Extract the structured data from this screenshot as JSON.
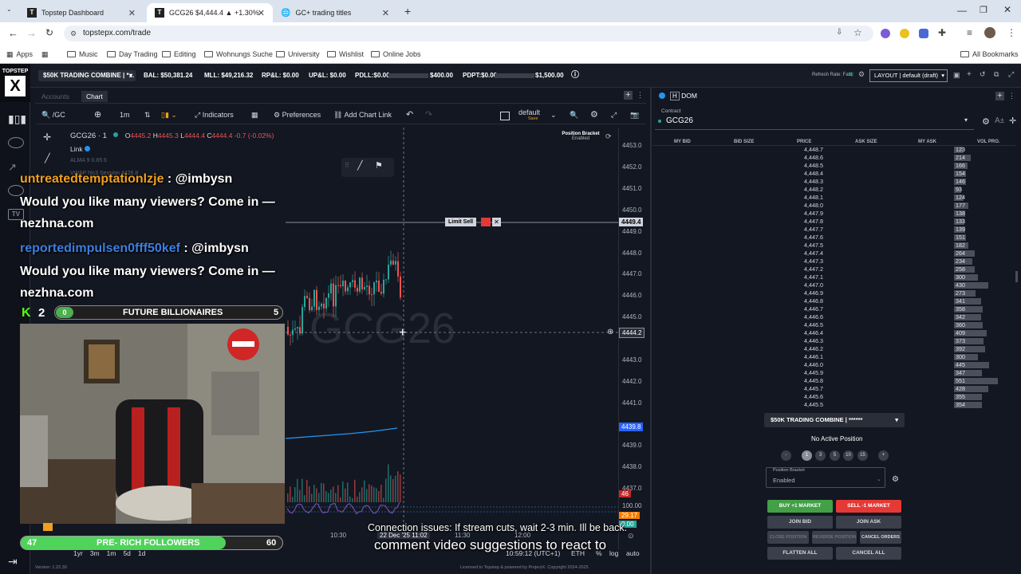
{
  "browser": {
    "tabs": [
      {
        "title": "Topstep Dashboard",
        "favicon": "T"
      },
      {
        "title": "GCG26 $4,444.4 ▲ +1.30%",
        "favicon": "T"
      },
      {
        "title": "GC+ trading titles",
        "favicon": "globe"
      }
    ],
    "url": "topstepx.com/trade",
    "bookmarks": [
      "Apps",
      "Music",
      "Day Trading",
      "Editing",
      "Wohnungs Suche",
      "University",
      "Wishlist",
      "Online Jobs"
    ],
    "all_bookmarks": "All Bookmarks"
  },
  "topbar": {
    "account": "$50K TRADING COMBINE | *...",
    "bal": "BAL: $50,381.24",
    "mll": "MLL: $49,216.32",
    "rpl": "RP&L: $0.00",
    "upl": "UP&L: $0.00",
    "pdll": "PDLL:$0.00",
    "pdll_limit": "$400.00",
    "pdpt": "PDPT:$0.00",
    "pdpt_limit": "$1,500.00",
    "refresh": "Refresh Rate: Fast",
    "layout": "LAYOUT | default (draft)"
  },
  "chart": {
    "tabs": [
      "Accounts",
      "Chart"
    ],
    "symbol_search": "/GC",
    "interval": "1m",
    "indicators": "Indicators",
    "preferences": "Preferences",
    "add_link": "Add Chart Link",
    "template": "default",
    "template_save": "Save",
    "instrument": "GCG26 · 1",
    "ohlc": {
      "o": "4445.2",
      "h": "4445.3",
      "l": "4444.4",
      "c": "4444.4",
      "chg": "-0.7 (-0.02%)"
    },
    "link": "Link",
    "alma": "ALMA 9 0.85 6",
    "vwap": "VWAP hlc3 Session 4426.8",
    "position_bracket": "Position Bracket",
    "position_bracket_status": "Enabled",
    "limit_sell": "Limit Sell",
    "watermark": "GCG26",
    "price_labels": [
      "4453.0",
      "4452.0",
      "4451.0",
      "4450.0",
      "4449.0",
      "4448.0",
      "4447.0",
      "4446.0",
      "4445.0",
      "4443.0",
      "4442.0",
      "4441.0",
      "4439.0",
      "4438.0",
      "4437.0"
    ],
    "limit_price": "4449.4",
    "current_price": "4444.2",
    "vwap_price": "4439.8",
    "osc_labels": {
      "high": "100.00",
      "mid": "29.17",
      "low": "0.00",
      "red": "46"
    },
    "time_labels": [
      "10:30",
      "22 Dec '25  11:02",
      "11:30",
      "12:00"
    ],
    "clock": "10:59:12 (UTC+1)",
    "eth": "ETH",
    "pct": "%",
    "log": "log",
    "auto": "auto",
    "ranges": [
      "1yr",
      "3m",
      "1m",
      "5d",
      "1d"
    ],
    "ohlc_colors": {
      "up": "#26a69a",
      "down": "#ef5350"
    }
  },
  "dom": {
    "title": "DOM",
    "contract_label": "Contract",
    "contract": "GCG26",
    "headers": [
      "MY BID",
      "BID SIZE",
      "PRICE",
      "ASK SIZE",
      "MY ASK",
      "VOL PRO."
    ],
    "rows": [
      {
        "price": "4,448.7",
        "vol": 123
      },
      {
        "price": "4,448.6",
        "vol": 214
      },
      {
        "price": "4,448.5",
        "vol": 166
      },
      {
        "price": "4,448.4",
        "vol": 154
      },
      {
        "price": "4,448.3",
        "vol": 146
      },
      {
        "price": "4,448.2",
        "vol": 93
      },
      {
        "price": "4,448.1",
        "vol": 124
      },
      {
        "price": "4,448.0",
        "vol": 177
      },
      {
        "price": "4,447.9",
        "vol": 138
      },
      {
        "price": "4,447.8",
        "vol": 133
      },
      {
        "price": "4,447.7",
        "vol": 139
      },
      {
        "price": "4,447.6",
        "vol": 151
      },
      {
        "price": "4,447.5",
        "vol": 182
      },
      {
        "price": "4,447.4",
        "vol": 264
      },
      {
        "price": "4,447.3",
        "vol": 234
      },
      {
        "price": "4,447.2",
        "vol": 258
      },
      {
        "price": "4,447.1",
        "vol": 300
      },
      {
        "price": "4,447.0",
        "vol": 430
      },
      {
        "price": "4,446.9",
        "vol": 273
      },
      {
        "price": "4,446.8",
        "vol": 341
      },
      {
        "price": "4,446.7",
        "vol": 358
      },
      {
        "price": "4,446.6",
        "vol": 342
      },
      {
        "price": "4,446.5",
        "vol": 360
      },
      {
        "price": "4,446.4",
        "vol": 409
      },
      {
        "price": "4,446.3",
        "vol": 373
      },
      {
        "price": "4,446.2",
        "vol": 392
      },
      {
        "price": "4,446.1",
        "vol": 300
      },
      {
        "price": "4,446.0",
        "vol": 445
      },
      {
        "price": "4,445.9",
        "vol": 347
      },
      {
        "price": "4,445.8",
        "vol": 551
      },
      {
        "price": "4,445.7",
        "vol": 428
      },
      {
        "price": "4,445.6",
        "vol": 355
      },
      {
        "price": "4,445.5",
        "vol": 354
      }
    ],
    "account": "$50K TRADING COMBINE | ******",
    "no_position": "No Active Position",
    "quantities": [
      "-",
      "1",
      "3",
      "5",
      "10",
      "15",
      "+"
    ],
    "bracket_label": "Position Bracket",
    "bracket_value": "Enabled",
    "buy": "BUY +1 MARKET",
    "sell": "SELL -1 MARKET",
    "join_bid": "JOIN BID",
    "join_ask": "JOIN ASK",
    "close_position": "CLOSE POSITION",
    "reverse_position": "REVERSE POSITION",
    "cancel_orders": "CANCEL ORDERS",
    "flatten_all": "FLATTEN ALL",
    "cancel_all": "CANCEL ALL"
  },
  "overlay": {
    "chat": [
      {
        "user": "untreatedtemptationlzje",
        "text": ": @imbysn",
        "msg": "Would you like many viewers? Come in — nezhna.com"
      },
      {
        "user": "reportedimpulsen0fff50kef",
        "text": ": @imbysn",
        "msg": "Would you like many viewers? Come in — nezhna.com"
      }
    ],
    "kick_count": "2",
    "goal1": {
      "left": "0",
      "label": "FUTURE BILLIONAIRES",
      "right": "5"
    },
    "goal2": {
      "left": "47",
      "label": "PRE- RICH FOLLOWERS",
      "right": "60"
    },
    "subtitle1": "Connection issues: If stream cuts, wait 2-3 min. Ill be back.",
    "subtitle2": "comment video suggestions to react to"
  },
  "footer": {
    "version": "Version: 1.22.30",
    "license": "Licensed to Topstep & powered by ProjectX. Copyright 2024-2025"
  }
}
